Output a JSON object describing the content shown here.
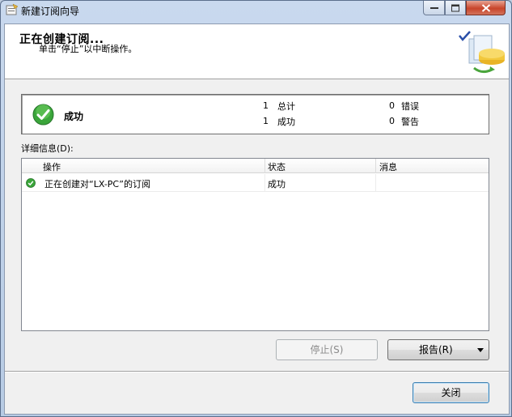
{
  "window": {
    "title": "新建订阅向导"
  },
  "header": {
    "title": "正在创建订阅...",
    "subtitle": "单击“停止”以中断操作。"
  },
  "status": {
    "result": "成功",
    "total_count": "1",
    "total_label": "总计",
    "success_count": "1",
    "success_label": "成功",
    "error_count": "0",
    "error_label": "错误",
    "warning_count": "0",
    "warning_label": "警告"
  },
  "details": {
    "label": "详细信息(D):",
    "columns": [
      "操作",
      "状态",
      "消息"
    ],
    "rows": [
      {
        "action": "正在创建对“LX-PC”的订阅",
        "status": "成功",
        "message": "",
        "icon": "success-icon"
      }
    ]
  },
  "buttons": {
    "stop": "停止(S)",
    "report": "报告(R)",
    "close": "关闭"
  },
  "colors": {
    "success_green": "#3aa53a",
    "close_red": "#c8442a"
  }
}
